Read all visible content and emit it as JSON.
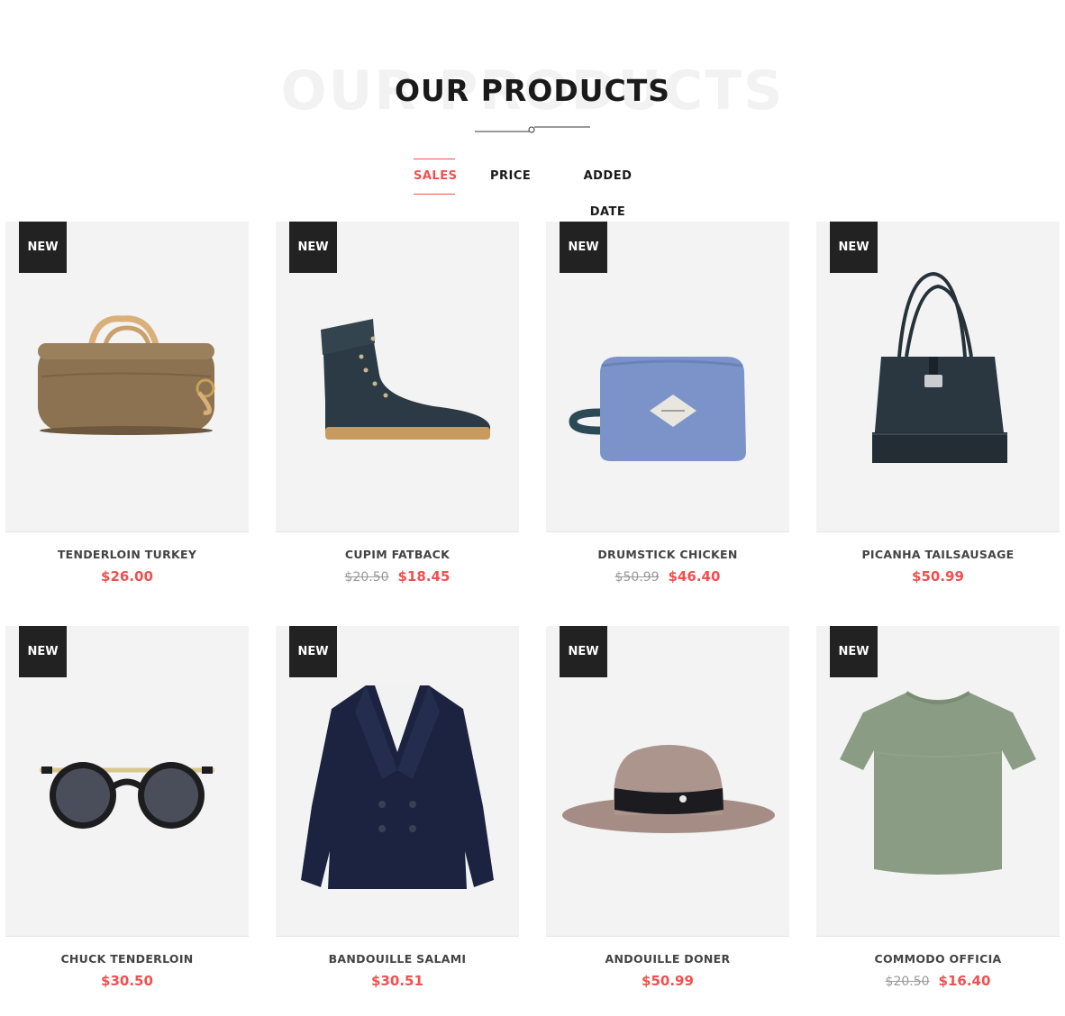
{
  "section": {
    "bg_title": "OUR PRODUCTS",
    "title": "OUR PRODUCTS"
  },
  "tabs": [
    {
      "label": "SALES",
      "active": true
    },
    {
      "label": "PRICE",
      "active": false
    },
    {
      "label": "ADDED DATE",
      "active": false
    }
  ],
  "colors": {
    "accent": "#f05050",
    "badge_bg": "#222222",
    "card_bg": "#f3f3f3"
  },
  "products": [
    {
      "badge": "NEW",
      "name": "TENDERLOIN TURKEY",
      "old_price": "",
      "price": "$26.00",
      "icon": "duffel-bag-icon"
    },
    {
      "badge": "NEW",
      "name": "CUPIM FATBACK",
      "old_price": "$20.50",
      "price": "$18.45",
      "icon": "boot-icon"
    },
    {
      "badge": "NEW",
      "name": "DRUMSTICK CHICKEN",
      "old_price": "$50.99",
      "price": "$46.40",
      "icon": "pouch-icon"
    },
    {
      "badge": "NEW",
      "name": "PICANHA TAILSAUSAGE",
      "old_price": "",
      "price": "$50.99",
      "icon": "tote-bag-icon"
    },
    {
      "badge": "NEW",
      "name": "CHUCK TENDERLOIN",
      "old_price": "",
      "price": "$30.50",
      "icon": "sunglasses-icon"
    },
    {
      "badge": "NEW",
      "name": "BANDOUILLE SALAMI",
      "old_price": "",
      "price": "$30.51",
      "icon": "coat-icon"
    },
    {
      "badge": "NEW",
      "name": "ANDOUILLE DONER",
      "old_price": "",
      "price": "$50.99",
      "icon": "hat-icon"
    },
    {
      "badge": "NEW",
      "name": "COMMODO OFFICIA",
      "old_price": "$20.50",
      "price": "$16.40",
      "icon": "tshirt-icon"
    }
  ]
}
